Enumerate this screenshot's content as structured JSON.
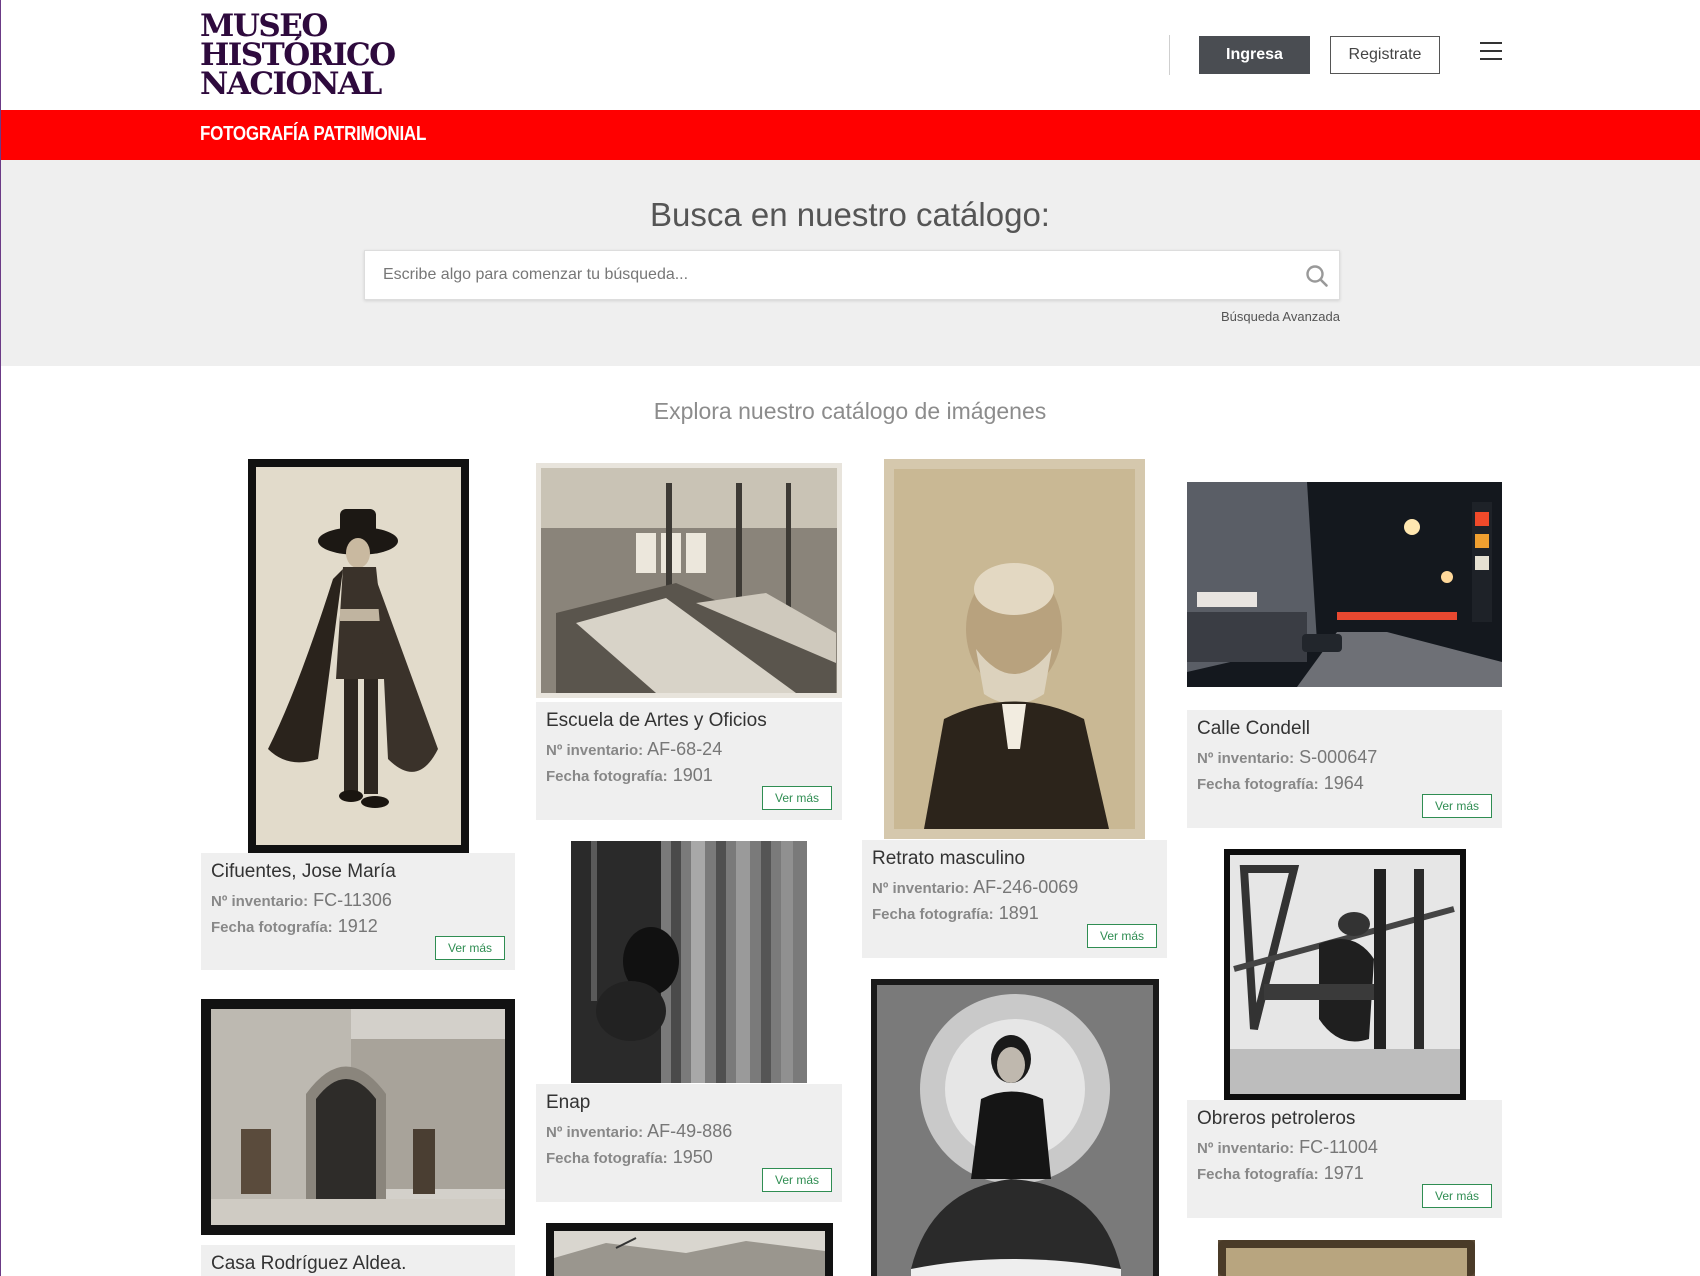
{
  "header": {
    "logo_lines": [
      "MUSEO",
      "HISTÓRICO",
      "NACIONAL"
    ],
    "login_label": "Ingresa",
    "register_label": "Registrate",
    "menu_icon": "hamburger-icon"
  },
  "section_band": {
    "label": "FOTOGRAFÍA PATRIMONIAL",
    "color": "#ff0000"
  },
  "search": {
    "title": "Busca en nuestro catálogo:",
    "placeholder": "Escribe algo para comenzar tu búsqueda...",
    "advanced_label": "Búsqueda Avanzada"
  },
  "catalog": {
    "title": "Explora nuestro catálogo de imágenes",
    "inventory_label": "Nº inventario:",
    "date_label": "Fecha fotografía:",
    "more_label": "Ver más",
    "items": [
      {
        "title": "Cifuentes, Jose María",
        "inventory": "FC-11306",
        "date": "1912"
      },
      {
        "title": "Escuela de Artes y Oficios",
        "inventory": "AF-68-24",
        "date": "1901"
      },
      {
        "title": "Retrato masculino",
        "inventory": "AF-246-0069",
        "date": "1891"
      },
      {
        "title": "Calle Condell",
        "inventory": "S-000647",
        "date": "1964"
      },
      {
        "title": "Enap",
        "inventory": "AF-49-886",
        "date": "1950"
      },
      {
        "title": "Obreros petroleros",
        "inventory": "FC-11004",
        "date": "1971"
      },
      {
        "title": "Casa Rodríguez Aldea.",
        "inventory": "",
        "date": ""
      }
    ]
  }
}
